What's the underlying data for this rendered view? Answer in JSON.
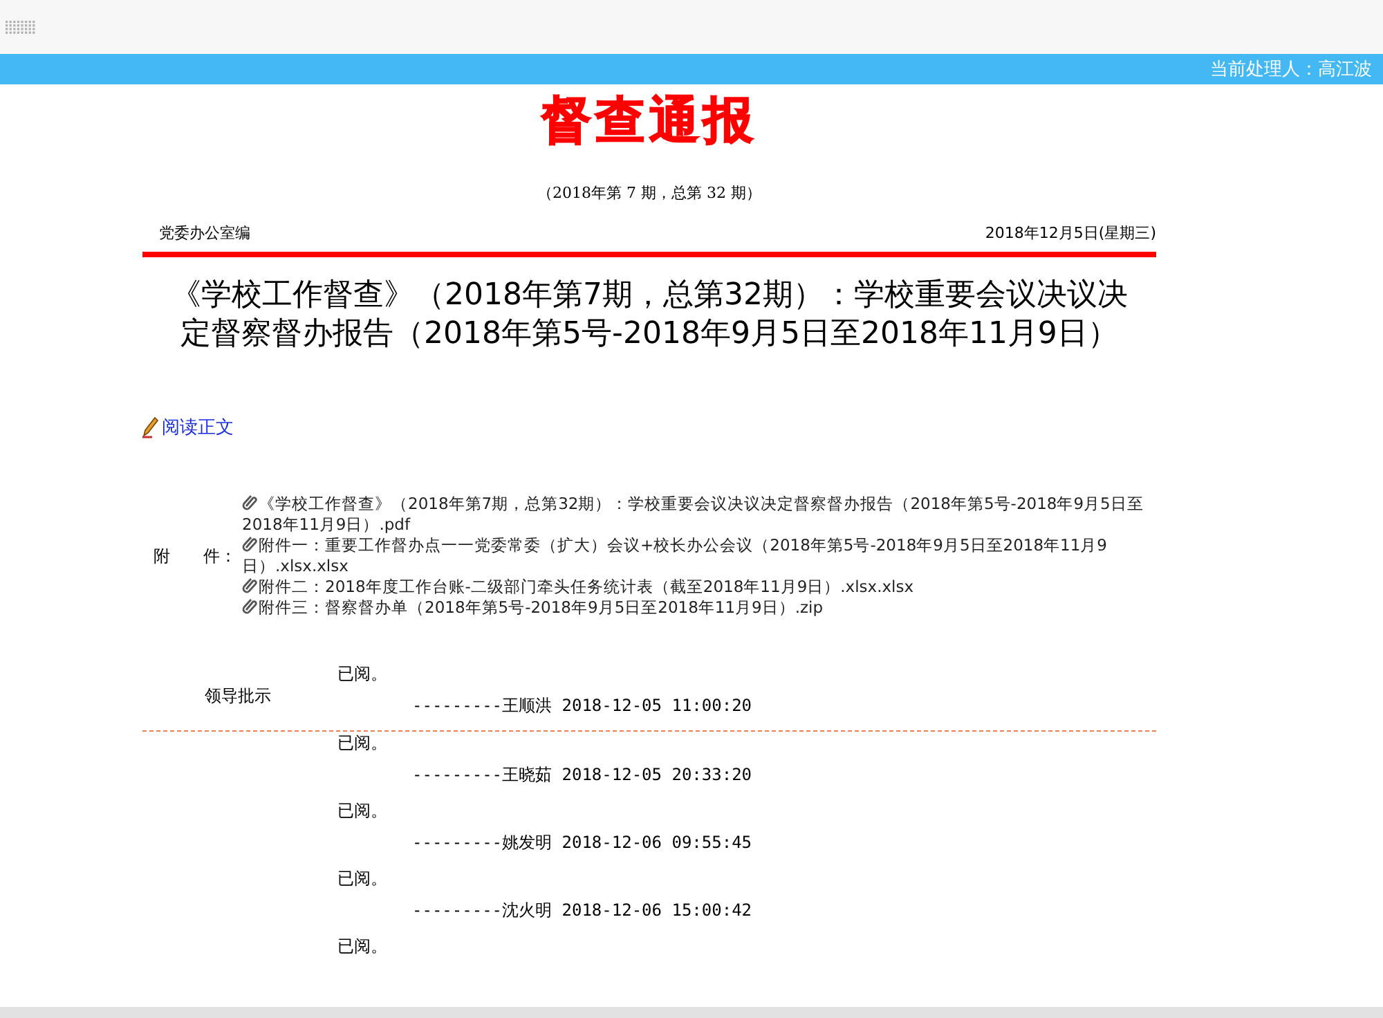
{
  "header_bar": {
    "current_handler": "当前处理人：高江波"
  },
  "bulletin": {
    "masthead": "督查通报",
    "issue": "（2018年第 7 期，总第 32 期）",
    "editor": "党委办公室编",
    "date": "2018年12月5日(星期三)"
  },
  "headline": "《学校工作督查》（2018年第7期，总第32期）：学校重要会议决议决定督察督办报告（2018年第5号-2018年9月5日至2018年11月9日）",
  "read_link": "阅读正文",
  "attachments": {
    "label": "附　　件：",
    "files": [
      {
        "name": "《学校工作督查》（2018年第7期，总第32期）：学校重要会议决议决定督察督办报告（2018年第5号-2018年9月5日至2018年11月9日）.pdf"
      },
      {
        "name": "附件一：重要工作督办点一一党委常委（扩大）会议+校长办公会议（2018年第5号-2018年9月5日至2018年11月9日）.xlsx.xlsx"
      },
      {
        "name": "附件二：2018年度工作台账-二级部门牵头任务统计表（截至2018年11月9日）.xlsx.xlsx"
      },
      {
        "name": "附件三：督察督办单（2018年第5号-2018年9月5日至2018年11月9日）.zip"
      }
    ]
  },
  "instructions": {
    "label": "领导批示",
    "entries": [
      {
        "comment": "已阅。",
        "signature": "---------王顺洪 2018-12-05 11:00:20"
      },
      {
        "comment": "已阅。",
        "signature": "---------王晓茹 2018-12-05 20:33:20"
      },
      {
        "comment": "已阅。",
        "signature": "---------姚发明 2018-12-06 09:55:45"
      },
      {
        "comment": "已阅。",
        "signature": "---------沈火明 2018-12-06 15:00:42"
      },
      {
        "comment": "已阅。"
      }
    ]
  }
}
